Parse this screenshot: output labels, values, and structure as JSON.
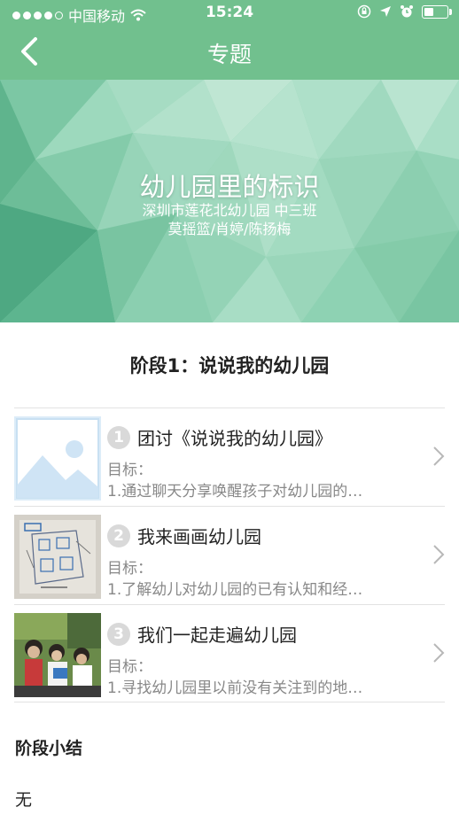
{
  "status_bar": {
    "carrier": "中国移动",
    "time": "15:24",
    "battery_level": 0.4
  },
  "nav": {
    "title": "专题",
    "back_icon": "chevron-left-icon"
  },
  "banner": {
    "title": "幼儿园里的标识",
    "school_class": "深圳市莲花北幼儿园 中三班",
    "teachers": "莫摇篮/肖婷/陈扬梅"
  },
  "stage": {
    "title": "阶段1：说说我的幼儿园"
  },
  "activities": [
    {
      "number": "1",
      "title": "团讨《说说我的幼儿园》",
      "goal_label": "目标：",
      "goal_text": "1.通过聊天分享唤醒孩子对幼儿园的…",
      "thumbnail": "placeholder-image-icon"
    },
    {
      "number": "2",
      "title": "我来画画幼儿园",
      "goal_label": "目标：",
      "goal_text": "1.了解幼儿对幼儿园的已有认知和经…",
      "thumbnail": "drawing-photo"
    },
    {
      "number": "3",
      "title": "我们一起走遍幼儿园",
      "goal_label": "目标：",
      "goal_text": "1.寻找幼儿园里以前没有关注到的地…",
      "thumbnail": "children-photo"
    }
  ],
  "summary": {
    "title": "阶段小结",
    "text": "无"
  },
  "colors": {
    "header": "#71c08e",
    "banner": "#8fd2b2",
    "muted_text": "#888888"
  }
}
